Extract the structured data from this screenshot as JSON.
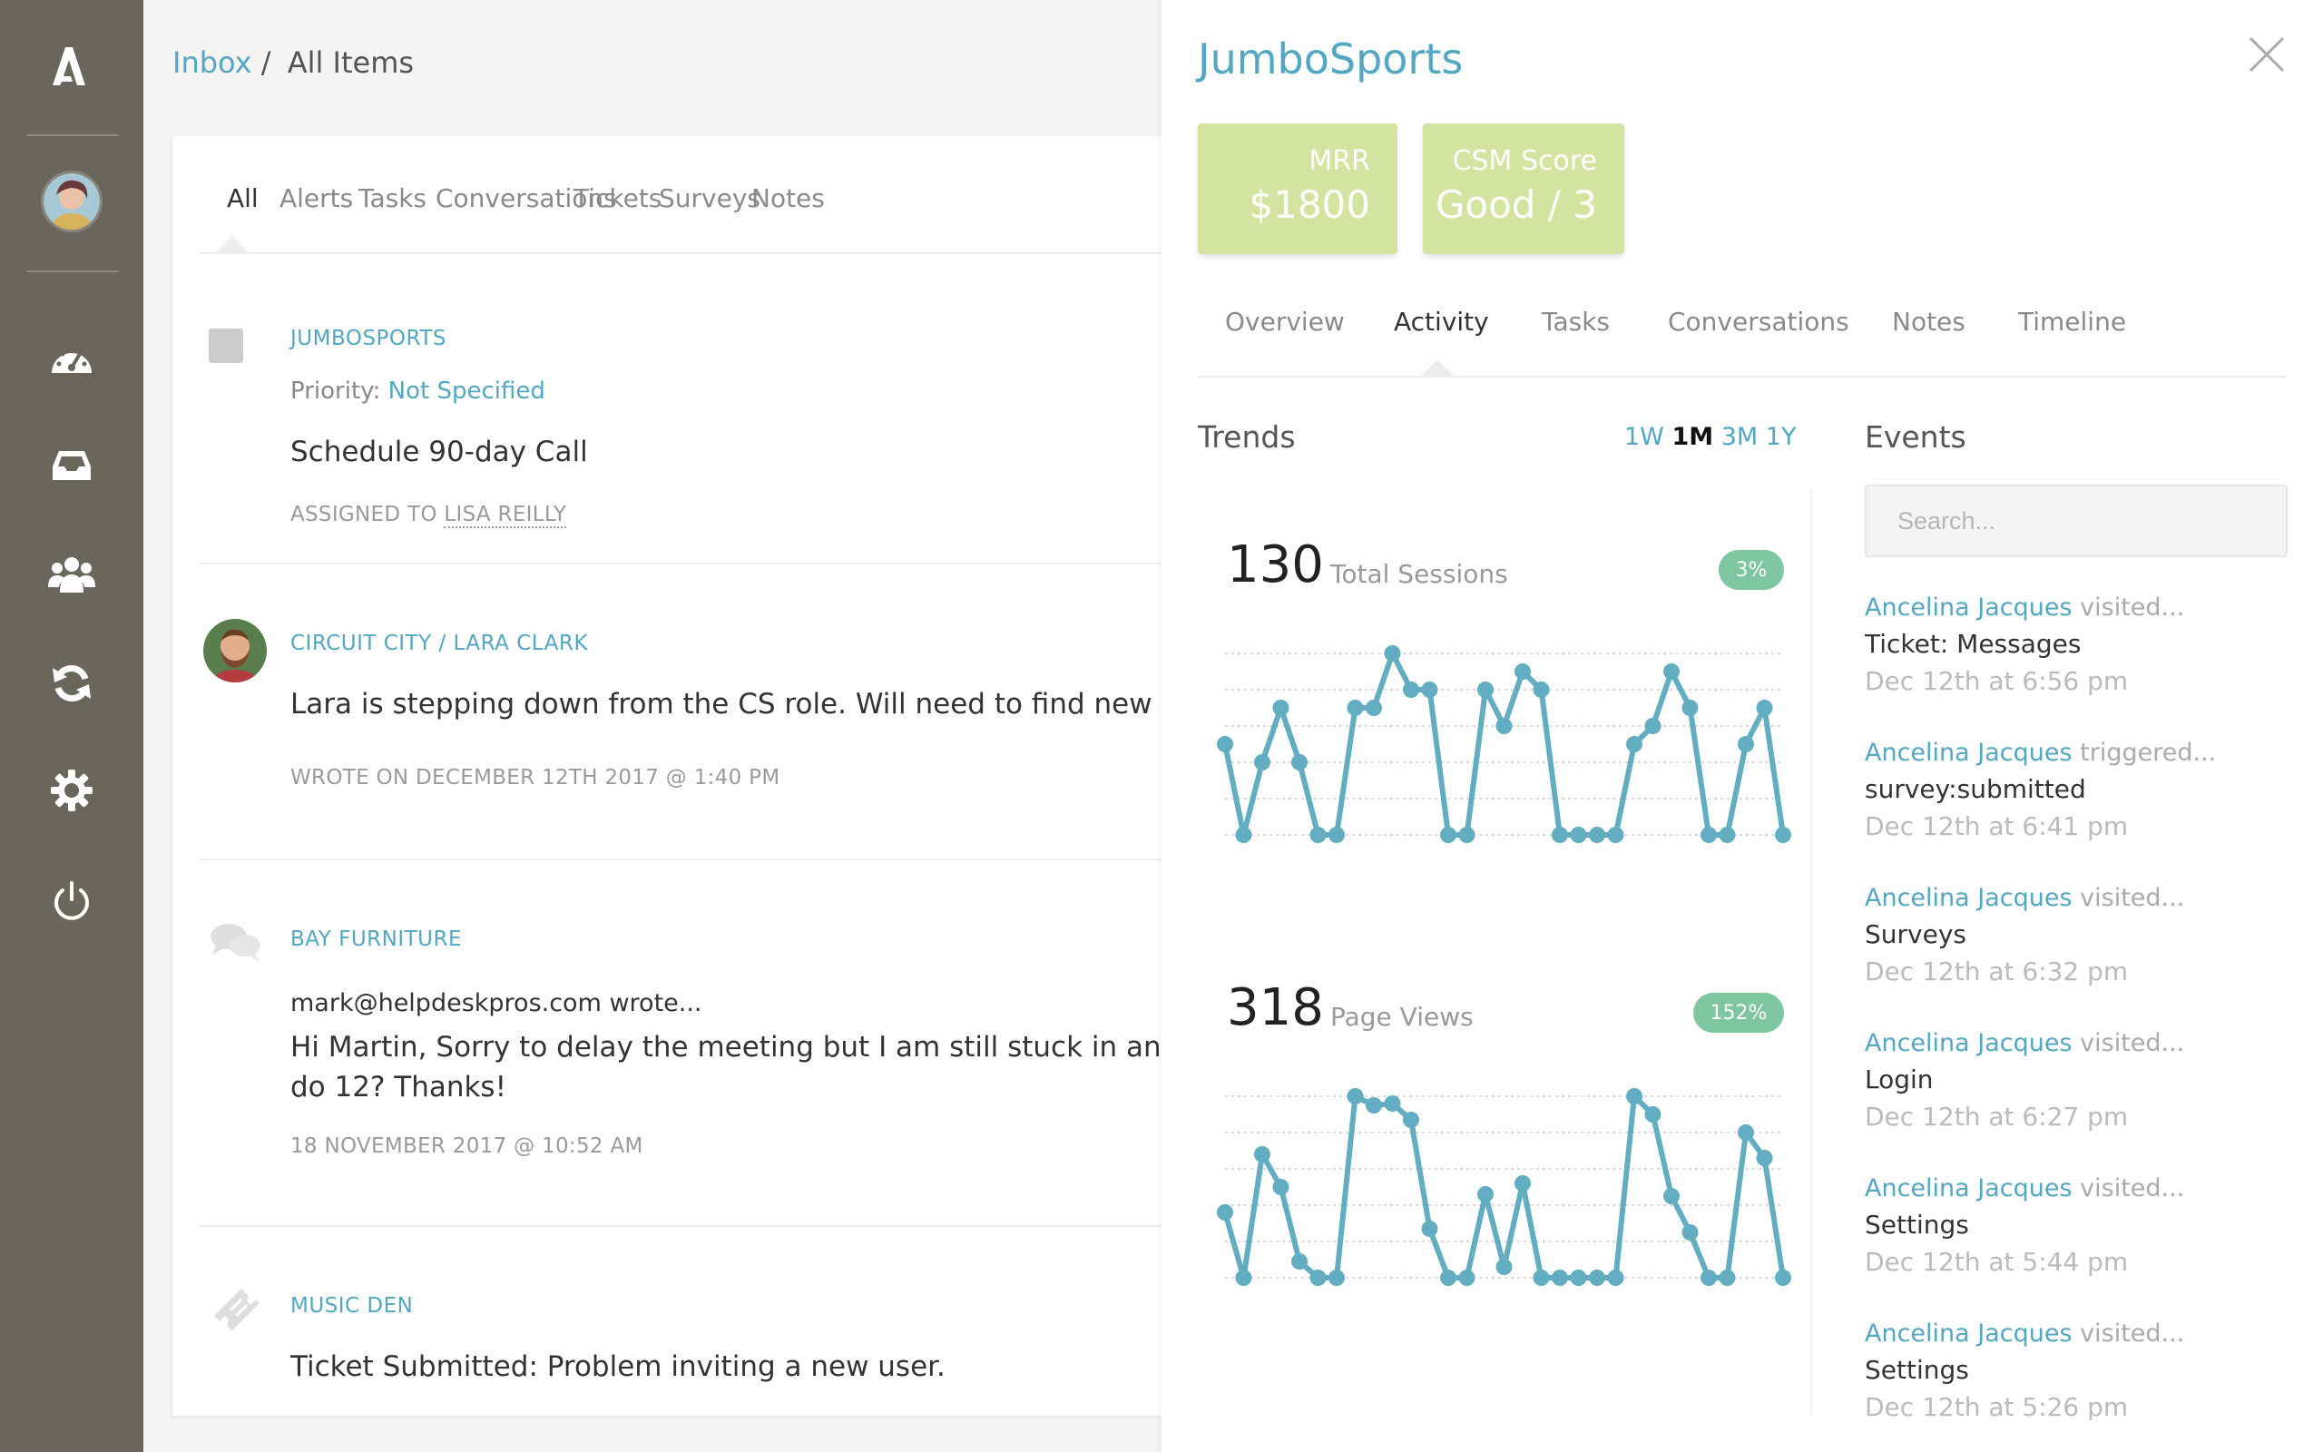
{
  "breadcrumb": {
    "inbox": "Inbox",
    "sep": "/",
    "current": "All Items"
  },
  "main_tabs": [
    "All",
    "Alerts",
    "Tasks",
    "Conversations",
    "Tickets",
    "Surveys",
    "Notes"
  ],
  "items": [
    {
      "tag": "JUMBOSPORTS",
      "priority_label": "Priority:",
      "priority_value": "Not Specified",
      "title": "Schedule 90-day Call",
      "assigned_label": "ASSIGNED TO",
      "assigned_to": "LISA REILLY"
    },
    {
      "tag": "CIRCUIT CITY / LARA CLARK",
      "text": "Lara is stepping down from the CS role. Will need to find new inte",
      "meta": "WROTE ON DECEMBER 12TH 2017 @ 1:40 PM"
    },
    {
      "tag": "BAY FURNITURE",
      "from": "mark@helpdeskpros.com wrote...",
      "text1": "Hi Martin, Sorry to delay the meeting but I am still stuck in anothe",
      "text2": "do 12? Thanks!",
      "meta": "18 NOVEMBER 2017 @ 10:52 AM"
    },
    {
      "tag": "MUSIC DEN",
      "text": "Ticket Submitted: Problem inviting a new user."
    }
  ],
  "detail": {
    "title": "JumboSports",
    "stats": [
      {
        "label": "MRR",
        "value": "$1800"
      },
      {
        "label": "CSM Score",
        "value": "Good / 3"
      }
    ],
    "tabs": [
      "Overview",
      "Activity",
      "Tasks",
      "Conversations",
      "Notes",
      "Timeline"
    ],
    "active_tab": "Activity",
    "trends_heading": "Trends",
    "ranges": [
      "1W",
      "1M",
      "3M",
      "1Y"
    ],
    "selected_range": "1M",
    "events_heading": "Events",
    "search_placeholder": "Search...",
    "metrics": [
      {
        "value": "130",
        "label": "Total Sessions",
        "change": "3%"
      },
      {
        "value": "318",
        "label": "Page Views",
        "change": "152%"
      }
    ],
    "events": [
      {
        "who": "Ancelina Jacques",
        "action": "visited...",
        "target": "Ticket: Messages",
        "time": "Dec 12th at 6:56 pm"
      },
      {
        "who": "Ancelina Jacques",
        "action": "triggered...",
        "target": "survey:submitted",
        "time": "Dec 12th at 6:41 pm"
      },
      {
        "who": "Ancelina Jacques",
        "action": "visited...",
        "target": "Surveys",
        "time": "Dec 12th at 6:32 pm"
      },
      {
        "who": "Ancelina Jacques",
        "action": "visited...",
        "target": "Login",
        "time": "Dec 12th at 6:27 pm"
      },
      {
        "who": "Ancelina Jacques",
        "action": "visited...",
        "target": "Settings",
        "time": "Dec 12th at 5:44 pm"
      },
      {
        "who": "Ancelina Jacques",
        "action": "visited...",
        "target": "Settings",
        "time": "Dec 12th at 5:26 pm"
      }
    ]
  },
  "chart_data": [
    {
      "type": "line",
      "series": [
        {
          "values": [
            0.5,
            0.0,
            0.4,
            0.7,
            0.4,
            0.0,
            0.0,
            0.7,
            0.7,
            1.0,
            0.8,
            0.8,
            0.0,
            0.0,
            0.8,
            0.6,
            0.9,
            0.8,
            0.0,
            0.0,
            0.0,
            0.0,
            0.5,
            0.6,
            0.9,
            0.7,
            0.0,
            0.0,
            0.5,
            0.7,
            0.0
          ]
        }
      ],
      "ylim": [
        0,
        1
      ],
      "grid": true
    },
    {
      "type": "line",
      "series": [
        {
          "values": [
            0.36,
            0.0,
            0.68,
            0.5,
            0.09,
            0.0,
            0.0,
            1.0,
            0.95,
            0.96,
            0.87,
            0.27,
            0.0,
            0.0,
            0.46,
            0.06,
            0.52,
            0.0,
            0.0,
            0.0,
            0.0,
            0.0,
            1.0,
            0.9,
            0.45,
            0.25,
            0.0,
            0.0,
            0.8,
            0.66,
            0.0
          ]
        }
      ],
      "ylim": [
        0,
        1
      ],
      "grid": true
    }
  ]
}
